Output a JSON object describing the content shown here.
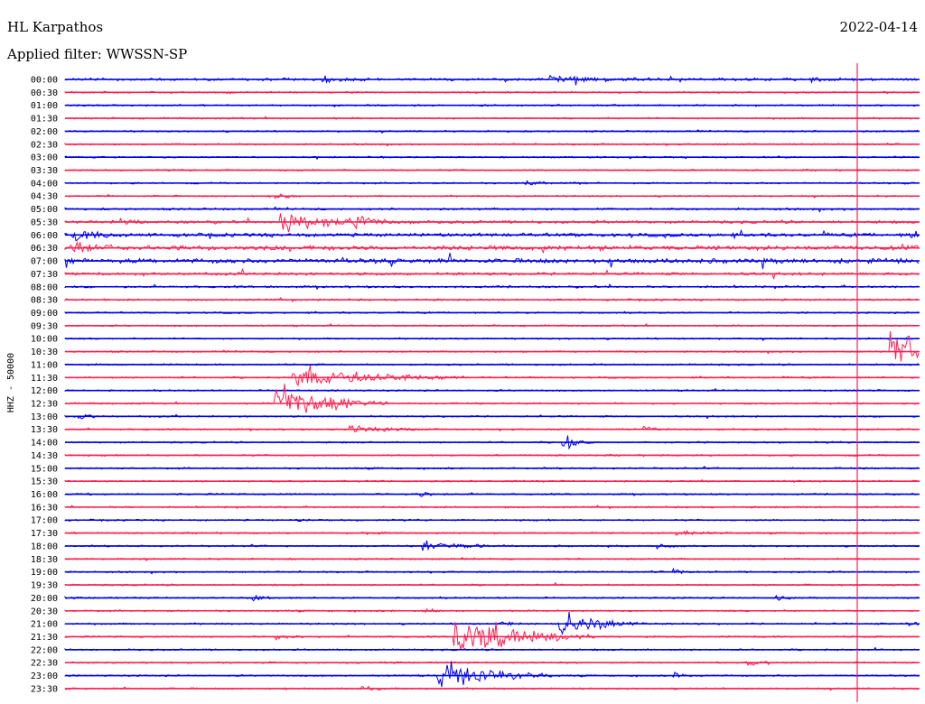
{
  "header": {
    "station": "HL Karpathos",
    "date": "2022-04-14",
    "filter": "Applied filter: WWSSN-SP"
  },
  "chart_data": {
    "type": "line",
    "title": "HL Karpathos",
    "subtitle": "Applied filter: WWSSN-SP",
    "ylabel": "HHZ - 50000",
    "row_labels": [
      "00:00",
      "00:30",
      "01:00",
      "01:30",
      "02:00",
      "02:30",
      "03:00",
      "03:30",
      "04:00",
      "04:30",
      "05:00",
      "05:30",
      "06:00",
      "06:30",
      "07:00",
      "07:30",
      "08:00",
      "08:30",
      "09:00",
      "09:30",
      "10:00",
      "10:30",
      "11:00",
      "11:30",
      "12:00",
      "12:30",
      "13:00",
      "13:30",
      "14:00",
      "14:30",
      "15:00",
      "15:30",
      "16:00",
      "16:30",
      "17:00",
      "17:30",
      "18:00",
      "18:30",
      "19:00",
      "19:30",
      "20:00",
      "20:30",
      "21:00",
      "21:30",
      "22:00",
      "22:30",
      "23:00",
      "23:30"
    ],
    "minutes_per_row": 30,
    "colors": {
      "even": "#0000ee",
      "odd": "#ff2050"
    },
    "noise_levels": [
      0.55,
      0.35,
      0.35,
      0.35,
      0.35,
      0.35,
      0.35,
      0.35,
      0.35,
      0.35,
      0.45,
      0.6,
      0.75,
      0.95,
      0.95,
      0.6,
      0.45,
      0.4,
      0.35,
      0.35,
      0.35,
      0.35,
      0.35,
      0.35,
      0.35,
      0.35,
      0.35,
      0.35,
      0.35,
      0.35,
      0.35,
      0.35,
      0.35,
      0.35,
      0.35,
      0.35,
      0.35,
      0.35,
      0.35,
      0.35,
      0.35,
      0.35,
      0.35,
      0.35,
      0.35,
      0.35,
      0.35,
      0.35
    ],
    "events": [
      {
        "row": 0,
        "minute": 9,
        "amp": 1.2,
        "dur": 2
      },
      {
        "row": 0,
        "minute": 17,
        "amp": 1.4,
        "dur": 4
      },
      {
        "row": 0,
        "minute": 26,
        "amp": 1.1,
        "dur": 2
      },
      {
        "row": 8,
        "minute": 16.2,
        "amp": 1.2,
        "dur": 1
      },
      {
        "row": 9,
        "minute": 7.4,
        "amp": 1.6,
        "dur": 1
      },
      {
        "row": 11,
        "minute": 10.2,
        "amp": 2.2,
        "dur": 2
      },
      {
        "row": 11,
        "minute": 2,
        "amp": 1.0,
        "dur": 1
      },
      {
        "row": 12,
        "minute": 0.3,
        "amp": 3.0,
        "dur": 2
      },
      {
        "row": 13,
        "minute": 0.2,
        "amp": 2.5,
        "dur": 2
      },
      {
        "row": 12,
        "minute": 29.7,
        "amp": 2.0,
        "dur": 1
      },
      {
        "row": 23,
        "minute": 8,
        "amp": 5.5,
        "dur": 6
      },
      {
        "row": 21,
        "minute": 29,
        "amp": 8.0,
        "dur": 4
      },
      {
        "row": 26,
        "minute": 0.5,
        "amp": 1.2,
        "dur": 1
      },
      {
        "row": 27,
        "minute": 10,
        "amp": 1.8,
        "dur": 3
      },
      {
        "row": 27,
        "minute": 20.3,
        "amp": 2.0,
        "dur": 1
      },
      {
        "row": 28,
        "minute": 17.5,
        "amp": 2.0,
        "dur": 1
      },
      {
        "row": 32,
        "minute": 12.5,
        "amp": 1.0,
        "dur": 1
      },
      {
        "row": 34,
        "minute": 8.1,
        "amp": 1.1,
        "dur": 1
      },
      {
        "row": 35,
        "minute": 10.4,
        "amp": 1.0,
        "dur": 1
      },
      {
        "row": 35,
        "minute": 21.5,
        "amp": 1.2,
        "dur": 2
      },
      {
        "row": 36,
        "minute": 12.6,
        "amp": 2.6,
        "dur": 3
      },
      {
        "row": 36,
        "minute": 20.8,
        "amp": 1.3,
        "dur": 1
      },
      {
        "row": 38,
        "minute": 21.4,
        "amp": 1.0,
        "dur": 1
      },
      {
        "row": 40,
        "minute": 6.6,
        "amp": 1.2,
        "dur": 1
      },
      {
        "row": 40,
        "minute": 25,
        "amp": 1.0,
        "dur": 1
      },
      {
        "row": 41,
        "minute": 12.7,
        "amp": 1.0,
        "dur": 1
      },
      {
        "row": 42,
        "minute": 15.3,
        "amp": 1.2,
        "dur": 1
      },
      {
        "row": 42,
        "minute": 29.5,
        "amp": 1.2,
        "dur": 1
      },
      {
        "row": 43,
        "minute": 7.4,
        "amp": 1.3,
        "dur": 1
      },
      {
        "row": 45,
        "minute": 24,
        "amp": 1.0,
        "dur": 2
      },
      {
        "row": 46,
        "minute": 21.4,
        "amp": 1.0,
        "dur": 1
      },
      {
        "row": 47,
        "minute": 10.4,
        "amp": 1.2,
        "dur": 1
      }
    ],
    "large_events": [
      {
        "row": 11,
        "minute": 7.6,
        "amp": 6,
        "dur": 3
      },
      {
        "row": 25,
        "minute": 7.4,
        "amp": 10,
        "dur": 4
      },
      {
        "row": 43,
        "minute": 13.7,
        "amp": 10,
        "dur": 5
      },
      {
        "row": 46,
        "minute": 13.1,
        "amp": 9,
        "dur": 4
      },
      {
        "row": 42,
        "minute": 17.4,
        "amp": 6,
        "dur": 3
      },
      {
        "row": 28,
        "minute": 17.5,
        "amp": 3,
        "dur": 1
      }
    ]
  }
}
